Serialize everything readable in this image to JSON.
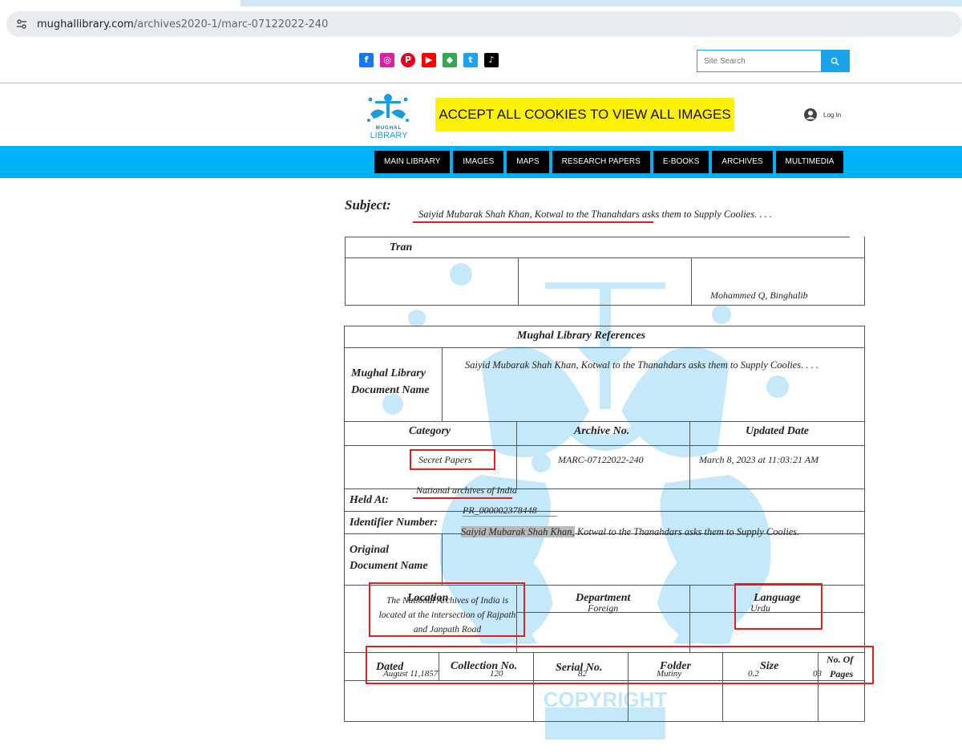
{
  "browser": {
    "url_domain": "mughallibrary.com",
    "url_path": "/archives2020-1/marc-07122022-240"
  },
  "social_icons": [
    "facebook-icon",
    "instagram-icon",
    "pinterest-icon",
    "youtube-icon",
    "google-maps-icon",
    "twitter-icon",
    "tiktok-icon"
  ],
  "search": {
    "placeholder": "Site Search"
  },
  "header": {
    "logo_small": "MUGHAL",
    "logo_large": "LIBRARY",
    "cookie_banner": "ACCEPT ALL COOKIES TO VIEW ALL IMAGES",
    "login": "Log In"
  },
  "nav": [
    "MAIN LIBRARY",
    "IMAGES",
    "MAPS",
    "RESEARCH PAPERS",
    "E-BOOKS",
    "ARCHIVES",
    "MULTIMEDIA"
  ],
  "document": {
    "subject_label": "Subject:",
    "subject_value": "Saiyid Mubarak Shah Khan, Kotwal to the Thanahdars asks them to Supply Coolies. . . .",
    "tran_label": "Tran",
    "translator": "Mohammed Q, Binghalib",
    "references_title": "Mughal Library References",
    "doc_name_label_1": "Mughal Library",
    "doc_name_label_2": "Document Name",
    "doc_name_value": "Saiyid Mubarak Shah Khan, Kotwal to the Thanahdars asks them to Supply Coolies. . . .",
    "category_label": "Category",
    "archive_label": "Archive No.",
    "updated_label": "Updated Date",
    "category_value": "Secret Papers",
    "archive_value": "MARC-07122022-240",
    "updated_value": "March 8, 2023 at 11:03:21 AM",
    "held_at_label": "Held At:",
    "held_at_value": "National archives of India",
    "identifier_label": "Identifier Number:",
    "identifier_value": "PR_000002378448",
    "original_label_1": "Original",
    "original_label_2": "Document Name",
    "original_value_highlight": "Saiyid Mubarak Shah Khan,",
    "original_value_rest": " Kotwal to the Thanahdars asks them to Supply Coolies.",
    "location_label": "Location",
    "location_value_1": "The National Archives of India is",
    "location_value_2": "located at the intersection of Rajpath",
    "location_value_3": "and Janpath Road",
    "department_label": "Department",
    "department_value": "Foreign",
    "language_label": "Language",
    "language_value": "Urdu",
    "dated_label": "Dated",
    "dated_value": "August 11,1857",
    "collection_label": "Collection No.",
    "collection_value": "120",
    "serial_label": "Serial No.",
    "serial_value": "82",
    "folder_label": "Folder",
    "folder_value": "Mutiny",
    "size_label": "Size",
    "size_value": "0.2",
    "pages_label_1": "No. Of",
    "pages_label_2": "Pages",
    "pages_value": "03",
    "watermark_text": "COPYRIGHT"
  },
  "colors": {
    "nav_bar": "#00b2f5",
    "cookie_banner": "#fff200",
    "annotation_red": "#e02020",
    "watermark": "#bfe6fa"
  }
}
